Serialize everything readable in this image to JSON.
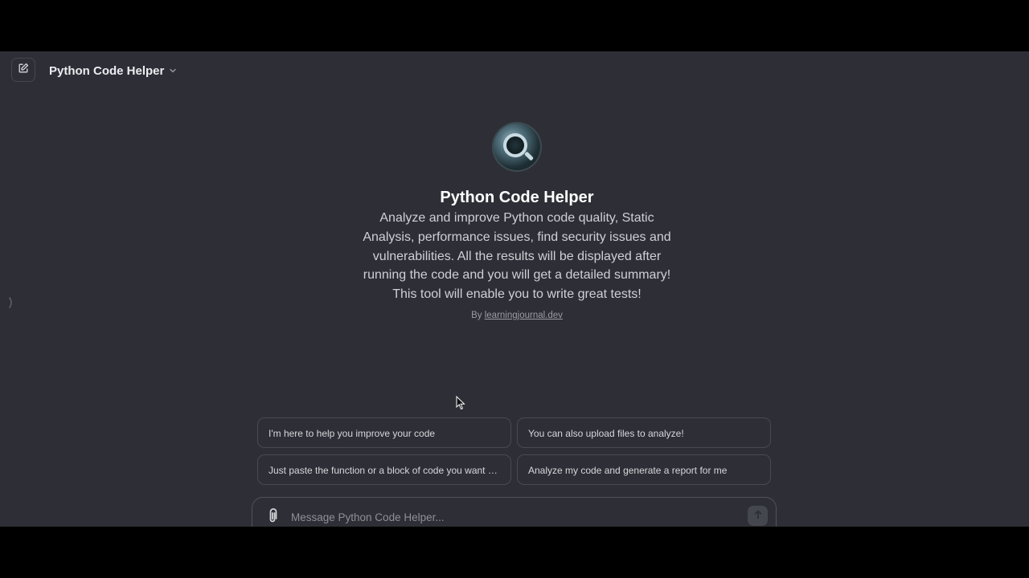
{
  "header": {
    "model_title": "Python Code Helper"
  },
  "gpt": {
    "title": "Python Code Helper",
    "description": "Analyze and improve Python code quality, Static Analysis, performance issues, find security issues and vulnerabilities. All the results will be displayed after running the code and you will get a detailed summary! This tool will enable you to write great tests!",
    "author_prefix": "By",
    "author_link": "learningjournal.dev"
  },
  "suggestions": [
    "I'm here to help you improve your code",
    "You can also upload files to analyze!",
    "Just paste the function or a block of code you want to...",
    "Analyze my code and generate a report for me"
  ],
  "composer": {
    "placeholder": "Message Python Code Helper..."
  },
  "icons": {
    "new_chat": "pencil-square-icon",
    "chevron": "chevron-down-icon",
    "attach": "paperclip-icon",
    "send": "arrow-up-icon",
    "sidebar_toggle": "sidebar-toggle-icon"
  },
  "colors": {
    "background": "#2e2f36",
    "text_primary": "#ececf1",
    "border": "#484a52"
  }
}
